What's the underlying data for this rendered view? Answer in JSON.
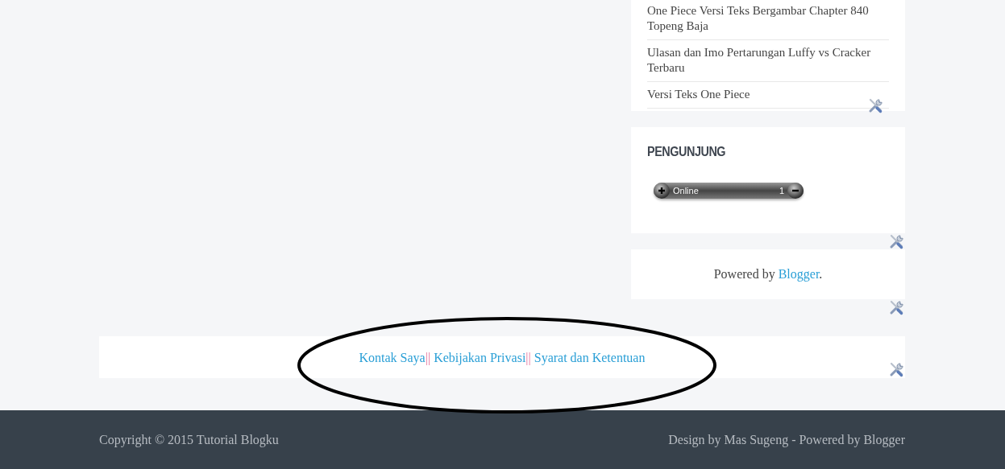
{
  "sidebar": {
    "posts": [
      "One Piece Versi Teks Bergambar Chapter 840 Topeng Baja",
      "Ulasan dan Imo Pertarungan Luffy vs Cracker Terbaru",
      "Versi Teks One Piece"
    ],
    "visitors": {
      "title": "PENGUNJUNG",
      "label": "Online",
      "count": "1"
    },
    "attribution": {
      "text": "Powered by ",
      "link": "Blogger",
      "after": "."
    }
  },
  "footer_links": [
    {
      "label": "Kontak Saya",
      "separator": "||"
    },
    {
      "label": "Kebijakan Privasi",
      "separator": "||"
    },
    {
      "label": "Syarat dan Ketentuan"
    }
  ],
  "footer": {
    "copyright": "Copyright © 2015 Tutorial Blogku",
    "credit": "Design by Mas Sugeng - Powered by Blogger"
  }
}
